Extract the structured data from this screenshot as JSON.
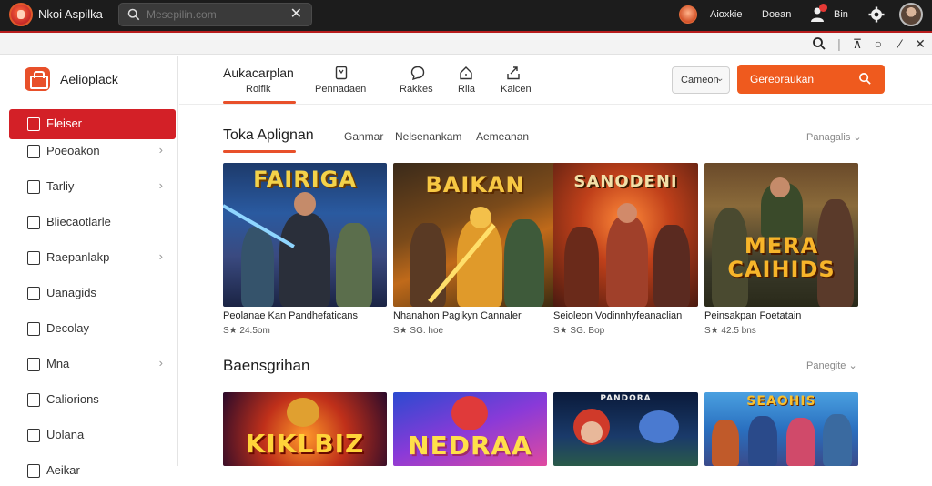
{
  "topbar": {
    "brand_name": "Nkoi Aspilka",
    "search_placeholder": "Mesepilin.com",
    "right_text_1": "Aioxkie",
    "right_text_2": "Doean",
    "right_text_3": "Bin",
    "notification_count": "4"
  },
  "sidebar": {
    "title": "Aelioplack",
    "items": [
      {
        "label": "Fleiser",
        "active": true,
        "chevron": false
      },
      {
        "label": "Poeoakon",
        "chevron": true
      },
      {
        "label": "Tarliy",
        "chevron": true
      },
      {
        "label": "Bliecaotlarle",
        "chevron": false
      },
      {
        "label": "Raepanlakp",
        "chevron": true
      },
      {
        "label": "Uanagids",
        "chevron": false
      },
      {
        "label": "Decolay",
        "chevron": false
      },
      {
        "label": "Mna",
        "chevron": true
      },
      {
        "label": "Caliorions",
        "chevron": false
      },
      {
        "label": "Uolana",
        "chevron": false
      },
      {
        "label": "Aeikar",
        "chevron": false
      }
    ]
  },
  "header": {
    "active_tab_title": "Aukacarplan",
    "active_tab_sub": "Rolfik",
    "tabs": [
      {
        "label": "Pennadaen",
        "icon": "bookmark-icon"
      },
      {
        "label": "Rakkes",
        "icon": "chat-icon"
      },
      {
        "label": "Rila",
        "icon": "home-icon"
      },
      {
        "label": "Kaicen",
        "icon": "share-icon"
      }
    ],
    "dropdown_label": "Cameon",
    "cta_label": "Gereoraukan"
  },
  "section1": {
    "title": "Toka Aplignan",
    "filters": [
      "Ganmar",
      "Nelsenankam",
      "Aemeanan"
    ],
    "sort_label": "Panagalis",
    "cards": [
      {
        "art_title": "FAIRIGA",
        "name": "Peolanae Kan Pandhefaticans",
        "meta": "S★ 24.5om"
      },
      {
        "art_title": "BAIKAN",
        "name": "Nhanahon Pagikyn Cannaler",
        "meta": "S★ SG. hoe"
      },
      {
        "art_title": "SANODENI",
        "name": "Seioleon Vodinnhyfeanaclian",
        "meta": "S★ SG. Bop"
      },
      {
        "art_title": "MERA CAIHIDS",
        "name": "Peinsakpan Foetatain",
        "meta": "S★ 42.5 bns"
      }
    ]
  },
  "section2": {
    "title": "Baensgrihan",
    "sort_label": "Panegite",
    "cards": [
      {
        "art_title": "KIKLBIZ"
      },
      {
        "art_title": "NEDRAA"
      },
      {
        "art_title": "PANDORA"
      },
      {
        "art_title": "SEAOHIS"
      }
    ]
  },
  "colors": {
    "accent": "#e8502a",
    "sidebar_active": "#d32027",
    "topbar": "#1c1c1c"
  }
}
